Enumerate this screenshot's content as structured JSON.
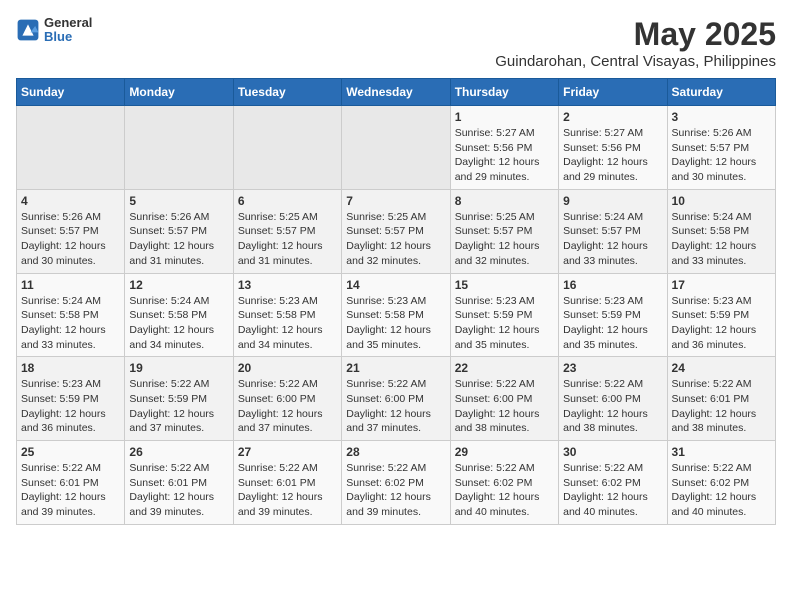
{
  "header": {
    "logo_line1": "General",
    "logo_line2": "Blue",
    "title": "May 2025",
    "subtitle": "Guindarohan, Central Visayas, Philippines"
  },
  "weekdays": [
    "Sunday",
    "Monday",
    "Tuesday",
    "Wednesday",
    "Thursday",
    "Friday",
    "Saturday"
  ],
  "weeks": [
    [
      {
        "day": "",
        "info": ""
      },
      {
        "day": "",
        "info": ""
      },
      {
        "day": "",
        "info": ""
      },
      {
        "day": "",
        "info": ""
      },
      {
        "day": "1",
        "info": "Sunrise: 5:27 AM\nSunset: 5:56 PM\nDaylight: 12 hours\nand 29 minutes."
      },
      {
        "day": "2",
        "info": "Sunrise: 5:27 AM\nSunset: 5:56 PM\nDaylight: 12 hours\nand 29 minutes."
      },
      {
        "day": "3",
        "info": "Sunrise: 5:26 AM\nSunset: 5:57 PM\nDaylight: 12 hours\nand 30 minutes."
      }
    ],
    [
      {
        "day": "4",
        "info": "Sunrise: 5:26 AM\nSunset: 5:57 PM\nDaylight: 12 hours\nand 30 minutes."
      },
      {
        "day": "5",
        "info": "Sunrise: 5:26 AM\nSunset: 5:57 PM\nDaylight: 12 hours\nand 31 minutes."
      },
      {
        "day": "6",
        "info": "Sunrise: 5:25 AM\nSunset: 5:57 PM\nDaylight: 12 hours\nand 31 minutes."
      },
      {
        "day": "7",
        "info": "Sunrise: 5:25 AM\nSunset: 5:57 PM\nDaylight: 12 hours\nand 32 minutes."
      },
      {
        "day": "8",
        "info": "Sunrise: 5:25 AM\nSunset: 5:57 PM\nDaylight: 12 hours\nand 32 minutes."
      },
      {
        "day": "9",
        "info": "Sunrise: 5:24 AM\nSunset: 5:57 PM\nDaylight: 12 hours\nand 33 minutes."
      },
      {
        "day": "10",
        "info": "Sunrise: 5:24 AM\nSunset: 5:58 PM\nDaylight: 12 hours\nand 33 minutes."
      }
    ],
    [
      {
        "day": "11",
        "info": "Sunrise: 5:24 AM\nSunset: 5:58 PM\nDaylight: 12 hours\nand 33 minutes."
      },
      {
        "day": "12",
        "info": "Sunrise: 5:24 AM\nSunset: 5:58 PM\nDaylight: 12 hours\nand 34 minutes."
      },
      {
        "day": "13",
        "info": "Sunrise: 5:23 AM\nSunset: 5:58 PM\nDaylight: 12 hours\nand 34 minutes."
      },
      {
        "day": "14",
        "info": "Sunrise: 5:23 AM\nSunset: 5:58 PM\nDaylight: 12 hours\nand 35 minutes."
      },
      {
        "day": "15",
        "info": "Sunrise: 5:23 AM\nSunset: 5:59 PM\nDaylight: 12 hours\nand 35 minutes."
      },
      {
        "day": "16",
        "info": "Sunrise: 5:23 AM\nSunset: 5:59 PM\nDaylight: 12 hours\nand 35 minutes."
      },
      {
        "day": "17",
        "info": "Sunrise: 5:23 AM\nSunset: 5:59 PM\nDaylight: 12 hours\nand 36 minutes."
      }
    ],
    [
      {
        "day": "18",
        "info": "Sunrise: 5:23 AM\nSunset: 5:59 PM\nDaylight: 12 hours\nand 36 minutes."
      },
      {
        "day": "19",
        "info": "Sunrise: 5:22 AM\nSunset: 5:59 PM\nDaylight: 12 hours\nand 37 minutes."
      },
      {
        "day": "20",
        "info": "Sunrise: 5:22 AM\nSunset: 6:00 PM\nDaylight: 12 hours\nand 37 minutes."
      },
      {
        "day": "21",
        "info": "Sunrise: 5:22 AM\nSunset: 6:00 PM\nDaylight: 12 hours\nand 37 minutes."
      },
      {
        "day": "22",
        "info": "Sunrise: 5:22 AM\nSunset: 6:00 PM\nDaylight: 12 hours\nand 38 minutes."
      },
      {
        "day": "23",
        "info": "Sunrise: 5:22 AM\nSunset: 6:00 PM\nDaylight: 12 hours\nand 38 minutes."
      },
      {
        "day": "24",
        "info": "Sunrise: 5:22 AM\nSunset: 6:01 PM\nDaylight: 12 hours\nand 38 minutes."
      }
    ],
    [
      {
        "day": "25",
        "info": "Sunrise: 5:22 AM\nSunset: 6:01 PM\nDaylight: 12 hours\nand 39 minutes."
      },
      {
        "day": "26",
        "info": "Sunrise: 5:22 AM\nSunset: 6:01 PM\nDaylight: 12 hours\nand 39 minutes."
      },
      {
        "day": "27",
        "info": "Sunrise: 5:22 AM\nSunset: 6:01 PM\nDaylight: 12 hours\nand 39 minutes."
      },
      {
        "day": "28",
        "info": "Sunrise: 5:22 AM\nSunset: 6:02 PM\nDaylight: 12 hours\nand 39 minutes."
      },
      {
        "day": "29",
        "info": "Sunrise: 5:22 AM\nSunset: 6:02 PM\nDaylight: 12 hours\nand 40 minutes."
      },
      {
        "day": "30",
        "info": "Sunrise: 5:22 AM\nSunset: 6:02 PM\nDaylight: 12 hours\nand 40 minutes."
      },
      {
        "day": "31",
        "info": "Sunrise: 5:22 AM\nSunset: 6:02 PM\nDaylight: 12 hours\nand 40 minutes."
      }
    ]
  ]
}
